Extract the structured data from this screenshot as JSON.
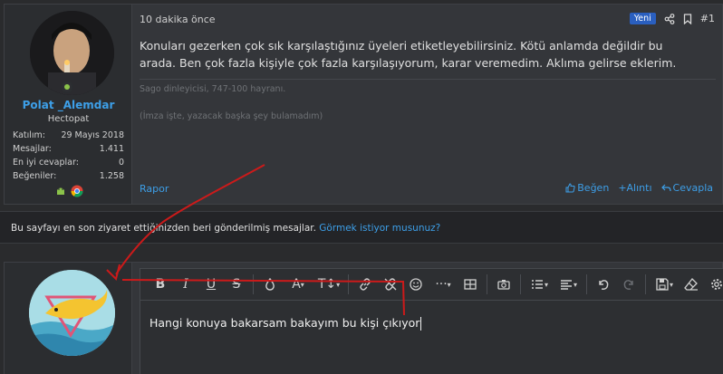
{
  "post": {
    "user": {
      "name": "Polat _Alemdar",
      "title": "Hectopat",
      "stats": [
        {
          "label": "Katılım:",
          "value": "29 Mayıs 2018"
        },
        {
          "label": "Mesajlar:",
          "value": "1.411"
        },
        {
          "label": "En iyi cevaplar:",
          "value": "0"
        },
        {
          "label": "Beğeniler:",
          "value": "1.258"
        }
      ]
    },
    "time": "10 dakika önce",
    "badge": "Yeni",
    "number": "#1",
    "message": "Konuları gezerken çok sık karşılaştığınız üyeleri etiketleyebilirsiniz. Kötü anlamda değildir bu arada. Ben çok fazla kişiyle çok fazla karşılaşıyorum, karar veremedim. Aklıma gelirse eklerim.",
    "signature_line1": "Sago dinleyicisi, 747-100 hayranı.",
    "signature_line2": "(İmza işte, yazacak başka şey bulamadım)",
    "report_label": "Rapor",
    "like_label": "Beğen",
    "quote_label": "+Alıntı",
    "reply_label": "Cevapla"
  },
  "notice": {
    "text": "Bu sayfayı en son ziyaret ettiğinizden beri gönderilmiş mesajlar.",
    "link": "Görmek istiyor musunuz?"
  },
  "editor": {
    "content": "Hangi konuya bakarsam bakayım bu kişi çıkıyor"
  },
  "colors": {
    "accent": "#3d9fe8",
    "annotation_arrow": "#cc1a1a",
    "badge_new": "#2a5fbf"
  }
}
